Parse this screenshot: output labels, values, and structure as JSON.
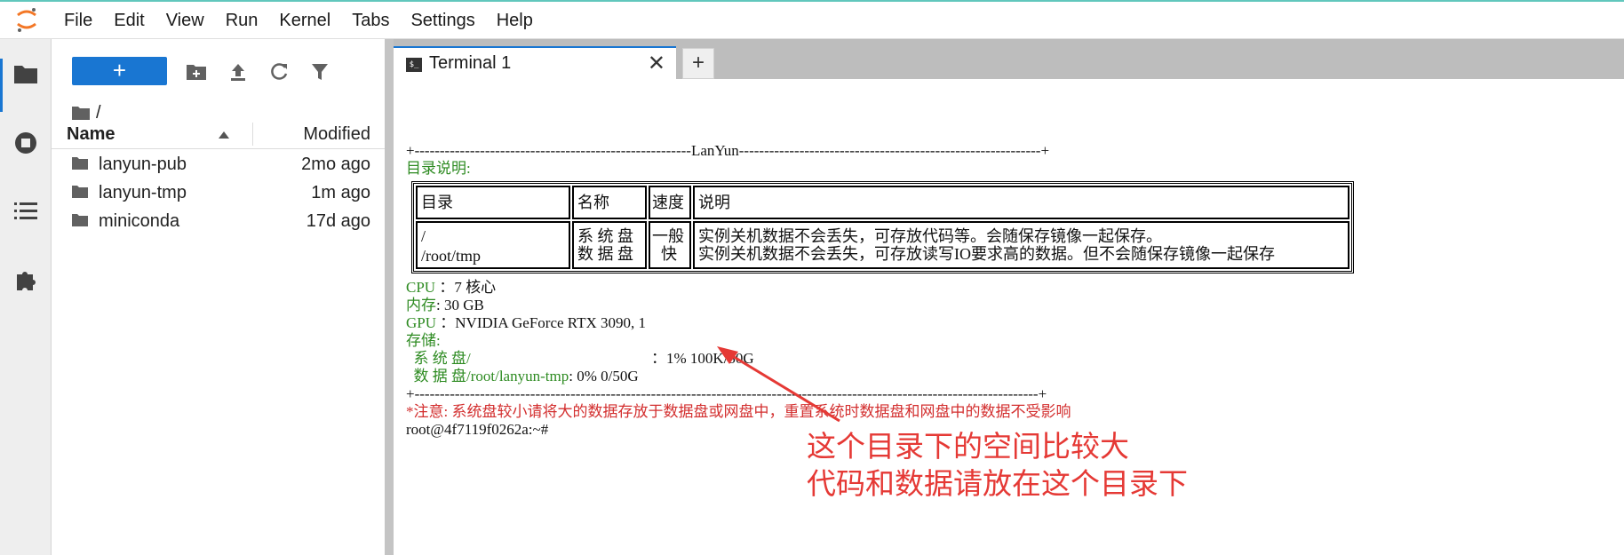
{
  "menu": [
    "File",
    "Edit",
    "View",
    "Run",
    "Kernel",
    "Tabs",
    "Settings",
    "Help"
  ],
  "colors": {
    "accent": "#1976d2",
    "terminal_green": "#2e8b22",
    "annotation_red": "#e53935"
  },
  "filebrowser": {
    "new_label": "+",
    "breadcrumb": "/",
    "col_name": "Name",
    "col_modified": "Modified",
    "files": [
      {
        "name": "lanyun-pub",
        "modified": "2mo ago"
      },
      {
        "name": "lanyun-tmp",
        "modified": "1m ago"
      },
      {
        "name": "miniconda",
        "modified": "17d ago"
      }
    ]
  },
  "tabs": {
    "terminal_label": "Terminal 1",
    "icon_text": "$_",
    "add_label": "+"
  },
  "terminal": {
    "rule_top": "+-------------------------------------------------------LanYun------------------------------------------------------------+",
    "dir_title": "目录说明:",
    "table": {
      "headers": [
        "目录",
        "名称",
        "速度",
        "说明"
      ],
      "row_dirs": [
        "/",
        "/root/tmp"
      ],
      "row_names": [
        "系 统 盘",
        "数 据 盘"
      ],
      "row_speed": [
        "一般",
        "快"
      ],
      "row_desc": [
        "实例关机数据不会丢失，可存放代码等。会随保存镜像一起保存。",
        "实例关机数据不会丢失，可存放读写IO要求高的数据。但不会随保存镜像一起保存"
      ]
    },
    "cpu_label": "CPU",
    "cpu_value": "：7 核心",
    "mem_label": "内存",
    "mem_value": ": 30 GB",
    "gpu_label": "GPU",
    "gpu_value": "：NVIDIA GeForce RTX 3090, 1",
    "storage_label": "存储:",
    "sys_disk_label": "  系 统 盘/",
    "sys_disk_value": "：1% 100K/30G",
    "data_disk_label": "  数 据 盘/root/lanyun-tmp",
    "data_disk_value": ": 0% 0/50G",
    "rule_bottom": "+----------------------------------------------------------------------------------------------------------------------------+",
    "note": "*注意: 系统盘较小请将大的数据存放于数据盘或网盘中，重置系统时数据盘和网盘中的数据不受影响",
    "prompt": "root@4f7119f0262a:~#"
  },
  "annotation": {
    "line1": "这个目录下的空间比较大",
    "line2": "代码和数据请放在这个目录下"
  },
  "icons": [
    "jupyter-logo-icon",
    "folder-icon",
    "running-icon",
    "toc-icon",
    "extension-icon",
    "new-folder-icon",
    "upload-icon",
    "refresh-icon",
    "filter-icon",
    "close-icon",
    "terminal-icon"
  ]
}
